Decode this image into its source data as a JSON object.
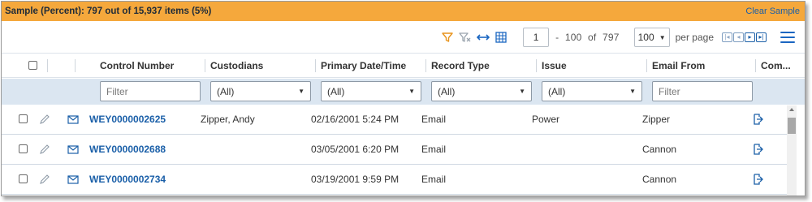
{
  "banner": {
    "text": "Sample (Percent): 797 out of 15,937 items (5%)",
    "clear_label": "Clear Sample",
    "color": "#f5a83c"
  },
  "toolbar": {
    "icons": [
      "filter-icon",
      "clear-filter-icon",
      "fit-columns-icon",
      "grid-icon"
    ],
    "page_value": "1",
    "range_dash": "-",
    "range_end": "100",
    "of_label": "of",
    "total": "797",
    "page_size": "100",
    "per_page_label": "per page",
    "nav": [
      "|<",
      "<",
      ">",
      ">|"
    ],
    "accent_color": "#1a66c1"
  },
  "columns": [
    "Control Number",
    "Custodians",
    "Primary Date/Time",
    "Record Type",
    "Issue",
    "Email From",
    "Com..."
  ],
  "filters": {
    "control_number_placeholder": "Filter",
    "custodians": "(All)",
    "primary_date": "(All)",
    "record_type": "(All)",
    "issue": "(All)",
    "email_from_placeholder": "Filter"
  },
  "rows": [
    {
      "control_number": "WEY0000002625",
      "custodians": "Zipper, Andy",
      "date": "02/16/2001 5:24 PM",
      "record_type": "Email",
      "issue": "Power",
      "email_from": "Zipper"
    },
    {
      "control_number": "WEY0000002688",
      "custodians": "",
      "date": "03/05/2001 6:20 PM",
      "record_type": "Email",
      "issue": "",
      "email_from": "Cannon"
    },
    {
      "control_number": "WEY0000002734",
      "custodians": "",
      "date": "03/19/2001 9:59 PM",
      "record_type": "Email",
      "issue": "",
      "email_from": "Cannon"
    }
  ]
}
